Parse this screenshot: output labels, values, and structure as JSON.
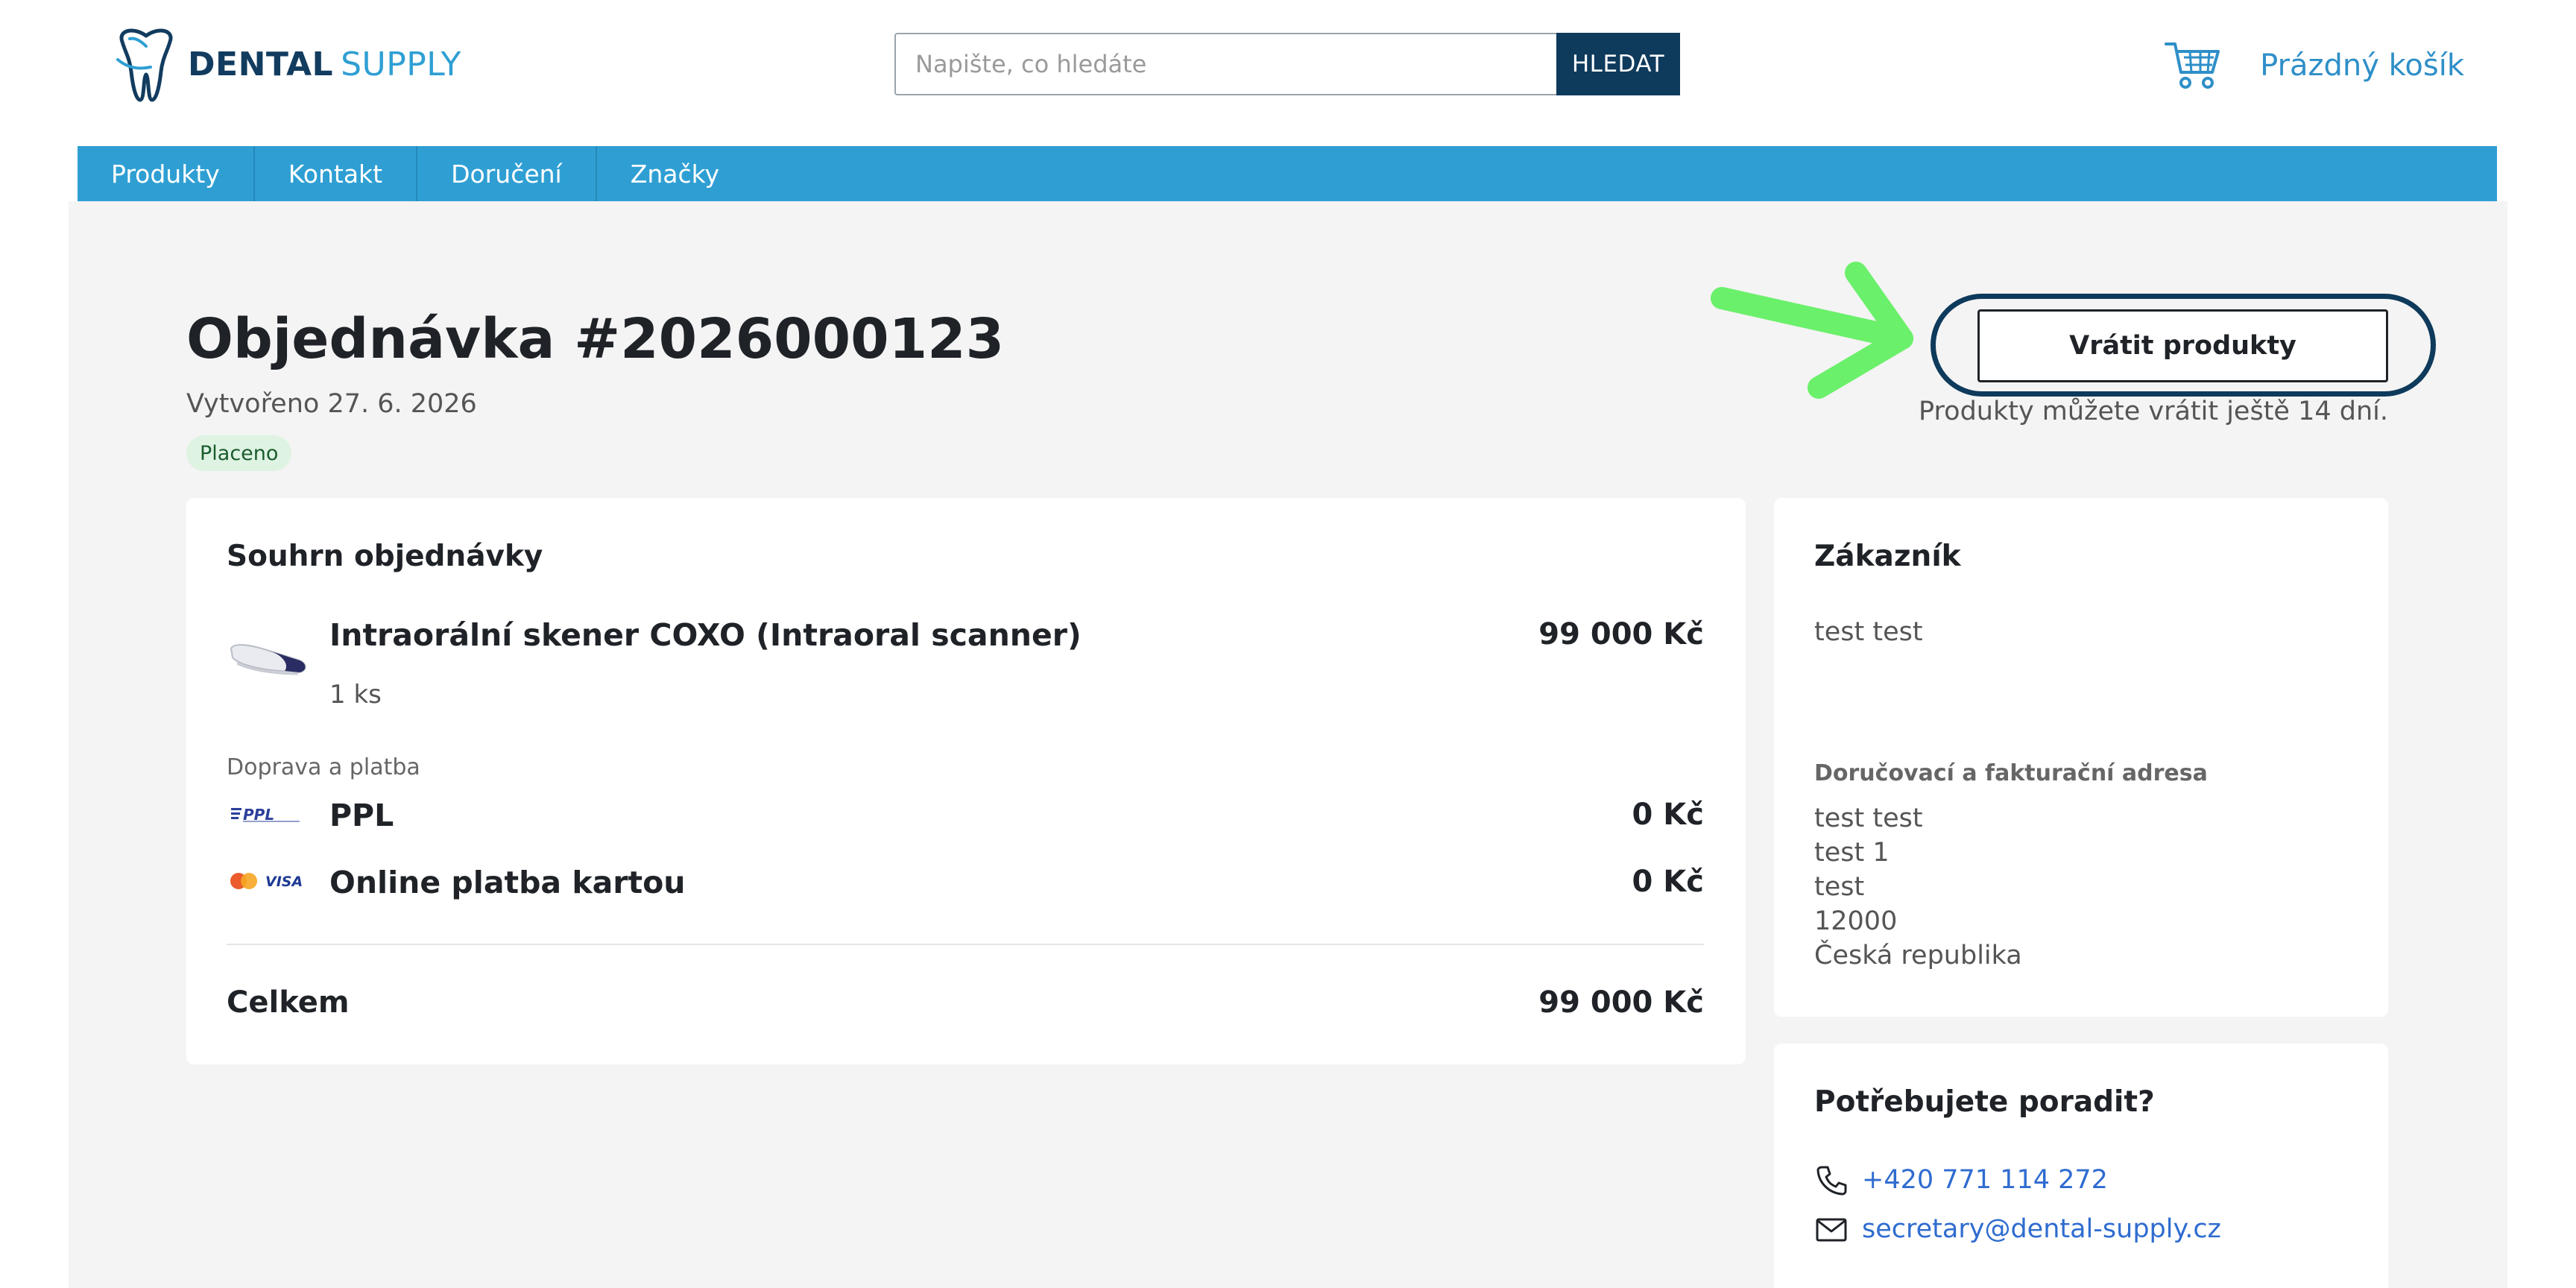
{
  "header": {
    "logo": {
      "word1": "DENTAL",
      "word2": "SUPPLY"
    },
    "search": {
      "placeholder": "Napište, co hledáte",
      "button_label": "HLEDAT"
    },
    "cart": {
      "label": "Prázdný košík",
      "icon": "cart-icon"
    }
  },
  "nav": {
    "items": [
      {
        "label": "Produkty"
      },
      {
        "label": "Kontakt"
      },
      {
        "label": "Doručení"
      },
      {
        "label": "Značky"
      }
    ]
  },
  "order": {
    "title": "Objednávka #2026000123",
    "created": "Vytvořeno 27. 6. 2026",
    "status": "Placeno",
    "return_button": "Vrátit produkty",
    "return_note": "Produkty můžete vrátit ještě 14 dní."
  },
  "summary": {
    "title": "Souhrn objednávky",
    "product": {
      "name": "Intraorální skener COXO (Intraoral scanner)",
      "qty": "1 ks",
      "price": "99 000 Kč"
    },
    "shipping_label": "Doprava a platba",
    "shipping": {
      "name": "PPL",
      "price": "0 Kč",
      "logo": "PPL"
    },
    "payment": {
      "name": "Online platba kartou",
      "price": "0 Kč",
      "logo": "VISA"
    },
    "total_label": "Celkem",
    "total_price": "99 000 Kč"
  },
  "customer": {
    "title": "Zákazník",
    "name": "test test",
    "address_label": "Doručovací a fakturační adresa",
    "address_lines": [
      "test test",
      "test 1",
      "test",
      "12000",
      "Česká republika"
    ]
  },
  "help": {
    "title": "Potřebujete poradit?",
    "phone": "+420 771 114 272",
    "email": "secretary@dental-supply.cz"
  },
  "colors": {
    "brand_dark": "#0e3a5c",
    "brand_light": "#2f9fd3",
    "nav_bg": "#2f9fd3",
    "annotation_arrow": "#6bf06b",
    "status_bg": "#dff3e3",
    "link": "#2f6cd0"
  }
}
